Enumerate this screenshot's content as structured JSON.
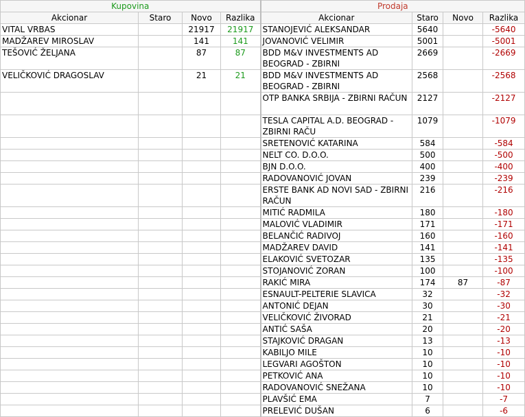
{
  "buy": {
    "title": "Kupovina",
    "headers": [
      "Akcionar",
      "Staro",
      "Novo",
      "Razlika"
    ],
    "rows": [
      {
        "name": "VITAL  VRBAS",
        "staro": "",
        "novo": "21917",
        "razlika": "21917"
      },
      {
        "name": "MADŽAREV MIROSLAV",
        "staro": "",
        "novo": "141",
        "razlika": "141"
      },
      {
        "name": "TEŠOVIĆ ŽELJANA",
        "staro": "",
        "novo": "87",
        "razlika": "87"
      },
      {
        "name": "VELIČKOVIĆ DRAGOSLAV",
        "staro": "",
        "novo": "21",
        "razlika": "21"
      }
    ]
  },
  "sell": {
    "title": "Prodaja",
    "headers": [
      "Akcionar",
      "Staro",
      "Novo",
      "Razlika"
    ],
    "rows": [
      {
        "name": "STANOJEVIĆ ALEKSANDAR",
        "staro": "5640",
        "novo": "",
        "razlika": "-5640"
      },
      {
        "name": "JOVANOVIĆ VELIMIR",
        "staro": "5001",
        "novo": "",
        "razlika": "-5001"
      },
      {
        "name": "BDD M&V INVESTMENTS AD BEOGRAD - ZBIRNI",
        "staro": "2669",
        "novo": "",
        "razlika": "-2669"
      },
      {
        "name": "BDD M&V INVESTMENTS AD BEOGRAD - ZBIRNI",
        "staro": "2568",
        "novo": "",
        "razlika": "-2568"
      },
      {
        "name": "OTP BANKA SRBIJA - ZBIRNI RAČUN",
        "staro": "2127",
        "novo": "",
        "razlika": "-2127"
      },
      {
        "name": "TESLA CAPITAL A.D. BEOGRAD - ZBIRNI RAČU",
        "staro": "1079",
        "novo": "",
        "razlika": "-1079"
      },
      {
        "name": "SRETENOVIĆ KATARINA",
        "staro": "584",
        "novo": "",
        "razlika": "-584"
      },
      {
        "name": "NELT CO. D.O.O.",
        "staro": "500",
        "novo": "",
        "razlika": "-500"
      },
      {
        "name": "BJN D.O.O.",
        "staro": "400",
        "novo": "",
        "razlika": "-400"
      },
      {
        "name": "RADOVANOVIĆ JOVAN",
        "staro": "239",
        "novo": "",
        "razlika": "-239"
      },
      {
        "name": "ERSTE BANK  AD NOVI SAD - ZBIRNI RAČUN",
        "staro": "216",
        "novo": "",
        "razlika": "-216"
      },
      {
        "name": "MITIĆ RADMILA",
        "staro": "180",
        "novo": "",
        "razlika": "-180"
      },
      {
        "name": "MALOVIĆ VLADIMIR",
        "staro": "171",
        "novo": "",
        "razlika": "-171"
      },
      {
        "name": "BELANČIĆ RADIVOJ",
        "staro": "160",
        "novo": "",
        "razlika": "-160"
      },
      {
        "name": "MADŽAREV DAVID",
        "staro": "141",
        "novo": "",
        "razlika": "-141"
      },
      {
        "name": "ELAKOVIĆ SVETOZAR",
        "staro": "135",
        "novo": "",
        "razlika": "-135"
      },
      {
        "name": "STOJANOVIĆ ZORAN",
        "staro": "100",
        "novo": "",
        "razlika": "-100"
      },
      {
        "name": "RAKIĆ MIRA",
        "staro": "174",
        "novo": "87",
        "razlika": "-87"
      },
      {
        "name": "ESNAULT-PELTERIE SLAVICA",
        "staro": "32",
        "novo": "",
        "razlika": "-32"
      },
      {
        "name": "ANTONIĆ DEJAN",
        "staro": "30",
        "novo": "",
        "razlika": "-30"
      },
      {
        "name": "VELIČKOVIĆ ŽIVORAD",
        "staro": "21",
        "novo": "",
        "razlika": "-21"
      },
      {
        "name": "ANTIĆ SAŠA",
        "staro": "20",
        "novo": "",
        "razlika": "-20"
      },
      {
        "name": "STAJKOVIĆ DRAGAN",
        "staro": "13",
        "novo": "",
        "razlika": "-13"
      },
      {
        "name": "KABILJO MILE",
        "staro": "10",
        "novo": "",
        "razlika": "-10"
      },
      {
        "name": "LEGVARI AGOŠTON",
        "staro": "10",
        "novo": "",
        "razlika": "-10"
      },
      {
        "name": "PETKOVIĆ ANA",
        "staro": "10",
        "novo": "",
        "razlika": "-10"
      },
      {
        "name": "RADOVANOVIĆ SNEŽANA",
        "staro": "10",
        "novo": "",
        "razlika": "-10"
      },
      {
        "name": "PLAVŠIĆ EMA",
        "staro": "7",
        "novo": "",
        "razlika": "-7"
      },
      {
        "name": "PRELEVIĆ DUŠAN",
        "staro": "6",
        "novo": "",
        "razlika": "-6"
      }
    ]
  },
  "colors": {
    "buy_title": "#1c9a1c",
    "sell_title": "#c0392b",
    "positive": "#1c9a1c",
    "negative": "#b00000",
    "grid": "#c8c8c8"
  }
}
